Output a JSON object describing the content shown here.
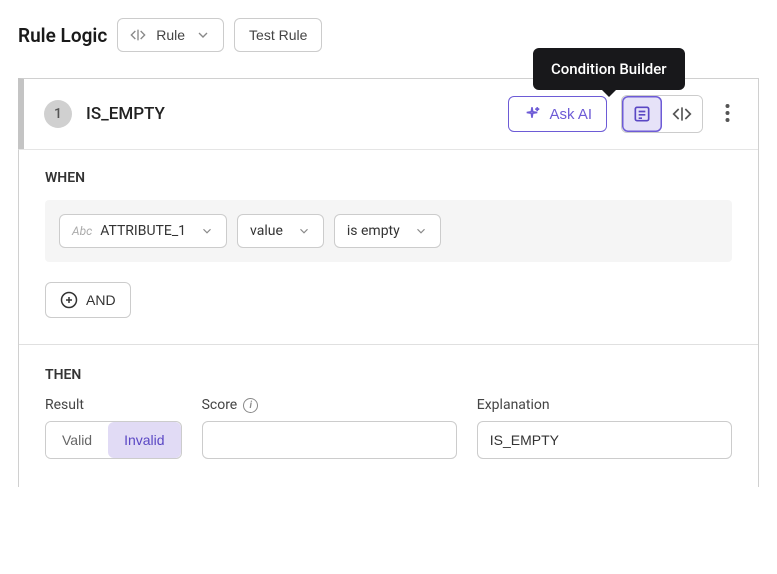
{
  "header": {
    "ruleLogicLabel": "Rule Logic",
    "ruleDropdownLabel": "Rule",
    "testRuleLabel": "Test Rule"
  },
  "tooltip": {
    "text": "Condition Builder"
  },
  "rule": {
    "number": "1",
    "name": "IS_EMPTY",
    "askAiLabel": "Ask AI"
  },
  "when": {
    "label": "WHEN",
    "attribute": "ATTRIBUTE_1",
    "valueType": "value",
    "operator": "is empty",
    "andLabel": "AND"
  },
  "then": {
    "label": "THEN",
    "resultLabel": "Result",
    "validLabel": "Valid",
    "invalidLabel": "Invalid",
    "scoreLabel": "Score",
    "explanationLabel": "Explanation",
    "explanationValue": "IS_EMPTY"
  }
}
